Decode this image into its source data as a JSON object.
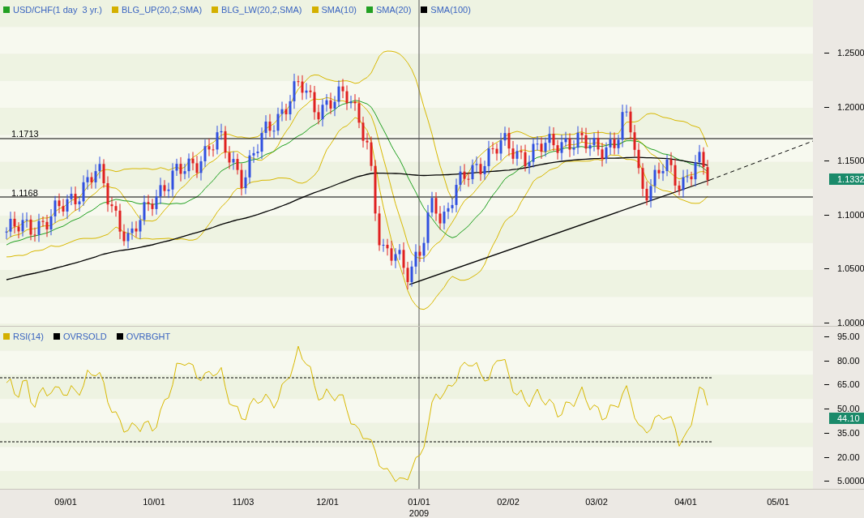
{
  "legend": [
    {
      "label": "USD/CHF(1 day  3 yr.)",
      "color": "#22a022"
    },
    {
      "label": "BLG_UP(20,2,SMA)",
      "color": "#d4b000"
    },
    {
      "label": "BLG_LW(20,2,SMA)",
      "color": "#d4b000"
    },
    {
      "label": "SMA(10)",
      "color": "#d4b000"
    },
    {
      "label": "SMA(20)",
      "color": "#22a022"
    },
    {
      "label": "SMA(100)",
      "color": "#000000"
    }
  ],
  "levels": [
    {
      "label": "1.1713"
    },
    {
      "label": "1.1168"
    }
  ],
  "price_axis": {
    "ticks": [
      "1.2500",
      "1.2000",
      "1.1500",
      "1.1000",
      "1.0500",
      "1.0000"
    ],
    "current": "1.1332"
  },
  "rsi_legend": [
    {
      "label": "RSI(14)",
      "color": "#d4b000"
    },
    {
      "label": "OVRSOLD",
      "color": "#000000"
    },
    {
      "label": "OVRBGHT",
      "color": "#000000"
    }
  ],
  "rsi_axis": {
    "ticks": [
      "95.00",
      "80.00",
      "65.00",
      "50.00",
      "35.00",
      "20.00",
      "5.0000"
    ],
    "current": "44.10"
  },
  "time_axis": {
    "ticks": [
      "09/01",
      "10/01",
      "11/03",
      "12/01",
      "01/01",
      "02/02",
      "03/02",
      "04/01",
      "05/01"
    ],
    "year": "2009"
  }
}
